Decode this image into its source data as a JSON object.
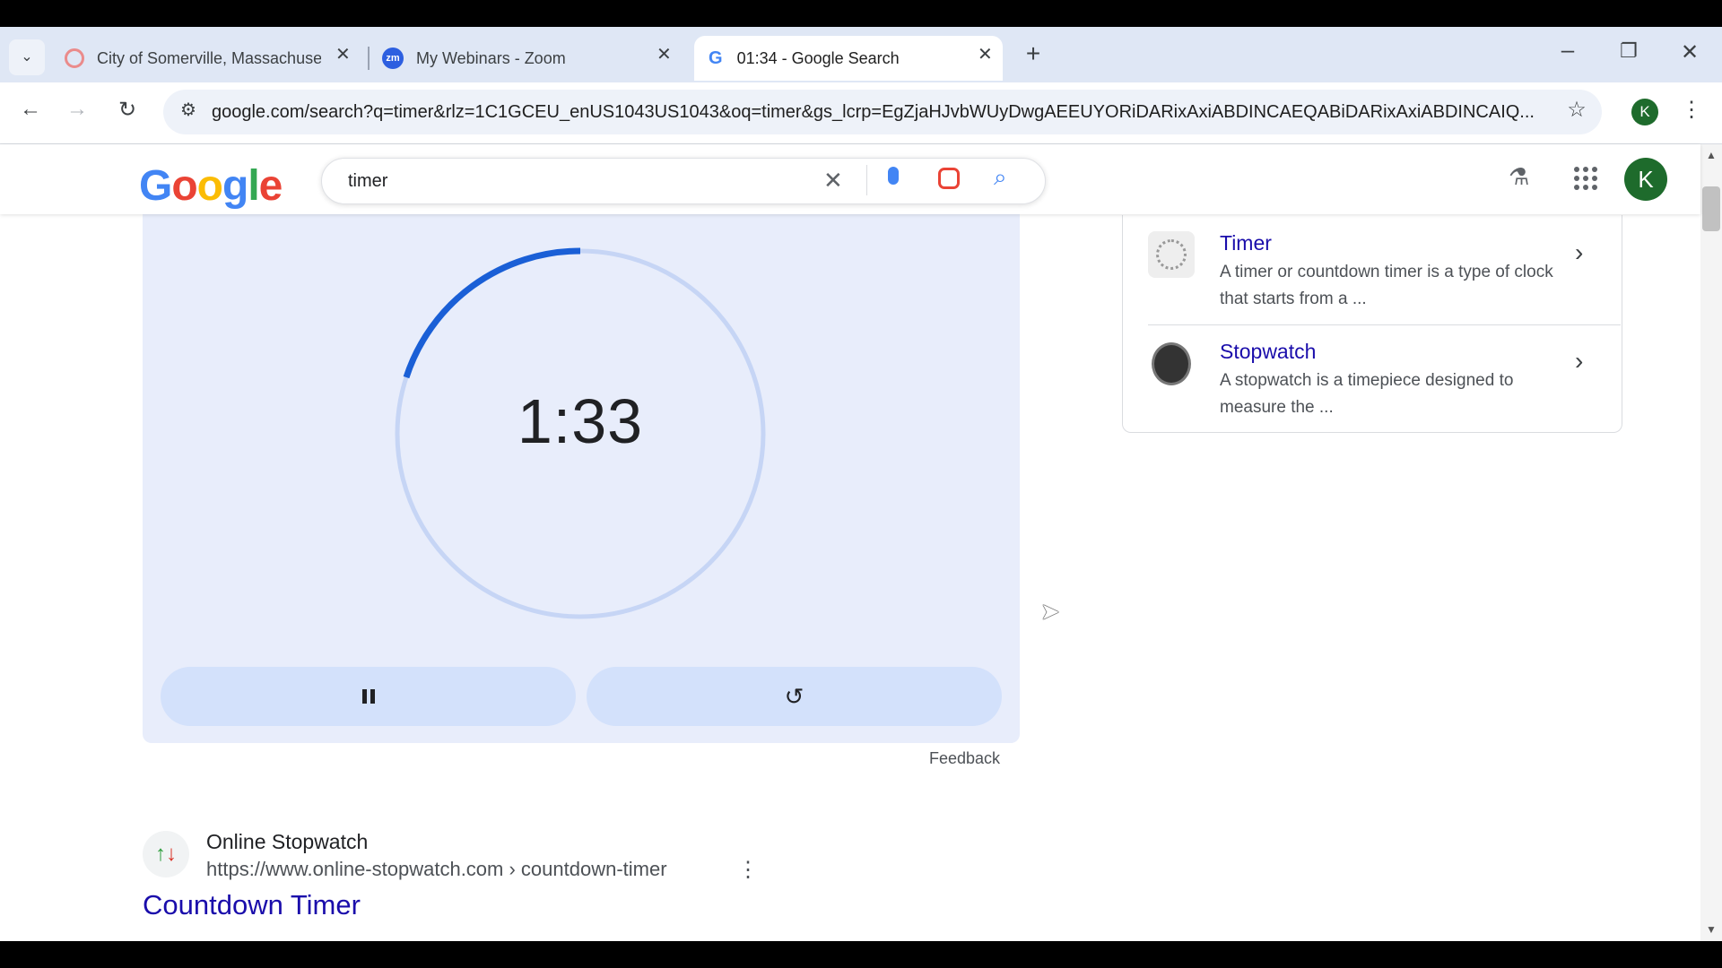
{
  "browser": {
    "tabs": [
      {
        "title": "City of Somerville, Massachuset",
        "active": false,
        "icon": "google-icon"
      },
      {
        "title": "My Webinars - Zoom",
        "active": false,
        "icon": "zoom-icon"
      },
      {
        "title": "01:34 - Google Search",
        "active": true,
        "icon": "google-icon"
      }
    ],
    "url": "google.com/search?q=timer&rlz=1C1GCEU_enUS1043US1043&oq=timer&gs_lcrp=EgZjaHJvbWUyDwgAEEUYORiDARixAxiABDINCAEQABiDARixAxiABDINCAIQ...",
    "profile_initial": "K"
  },
  "google": {
    "logo": "Google",
    "query": "timer",
    "avatar_initial": "K"
  },
  "timer": {
    "display": "1:33",
    "remaining_fraction": 0.2,
    "feedback": "Feedback"
  },
  "knowledge_panel": {
    "items": [
      {
        "title": "Timer",
        "description": "A timer or countdown timer is a type of clock that starts from a ..."
      },
      {
        "title": "Stopwatch",
        "description": "A stopwatch is a timepiece designed to measure the ..."
      }
    ]
  },
  "result": {
    "site_name": "Online Stopwatch",
    "url": "https://www.online-stopwatch.com › countdown-timer",
    "title": "Countdown Timer"
  },
  "colors": {
    "timer_arc": "#1a5fd6",
    "timer_track": "#c6d5f5",
    "profile_green": "#1e6b2c",
    "link_blue": "#1a0dab"
  }
}
